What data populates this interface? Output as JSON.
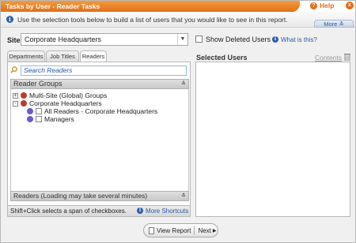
{
  "window": {
    "title": "Tasks by User - Reader Tasks",
    "help_label": "Help",
    "close_glyph": "x"
  },
  "info": {
    "text": "Use the selection tools below to build a list of users that you would like to see in this report.",
    "more_label": "More"
  },
  "site": {
    "label": "Site",
    "value": "Corporate Headquarters"
  },
  "deleted": {
    "label": "Show Deleted Users",
    "checked": false,
    "what_link": "What is this?"
  },
  "tabs": [
    {
      "label": "Departments",
      "active": false
    },
    {
      "label": "Job Titles",
      "active": false
    },
    {
      "label": "Readers",
      "active": true
    }
  ],
  "search": {
    "placeholder": "Search Readers"
  },
  "reader_groups": {
    "header": "Reader Groups",
    "items": [
      {
        "label": "Multi-Site (Global) Groups",
        "expander": "+"
      },
      {
        "label": "Corporate Headquarters",
        "expander": "-"
      },
      {
        "label": "All Readers - Corporate Headquarters"
      },
      {
        "label": "Managers"
      }
    ]
  },
  "readers_footer": "Readers (Loading may take several minutes)",
  "shift_hint": "Shift+Click selects a span of checkboxes.",
  "shortcuts_link": "More Shortcuts",
  "selected": {
    "title": "Selected Users",
    "contents_link": "Contents"
  },
  "footer": {
    "view_report": "View Report",
    "next": "Next"
  },
  "colors": {
    "title_orange": "#e0701a",
    "link_blue": "#2a5aa5"
  }
}
